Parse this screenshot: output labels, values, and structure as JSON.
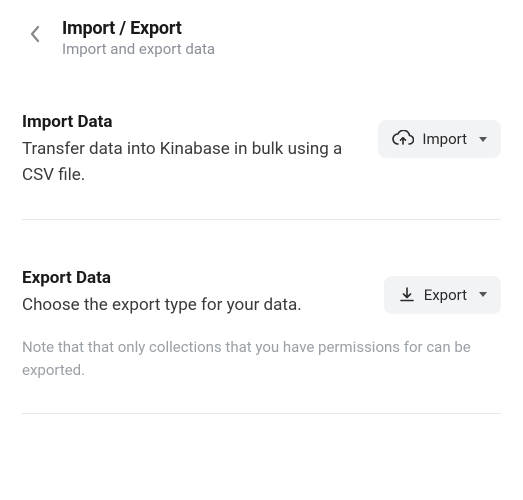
{
  "header": {
    "title": "Import / Export",
    "subtitle": "Import and export data"
  },
  "sections": {
    "import": {
      "title": "Import Data",
      "description": "Transfer data into Kinabase in bulk using a CSV file.",
      "button_label": "Import"
    },
    "export": {
      "title": "Export Data",
      "description": "Choose the export type for your data.",
      "button_label": "Export",
      "note": "Note that that only collections that you have permissions for can be exported."
    }
  }
}
